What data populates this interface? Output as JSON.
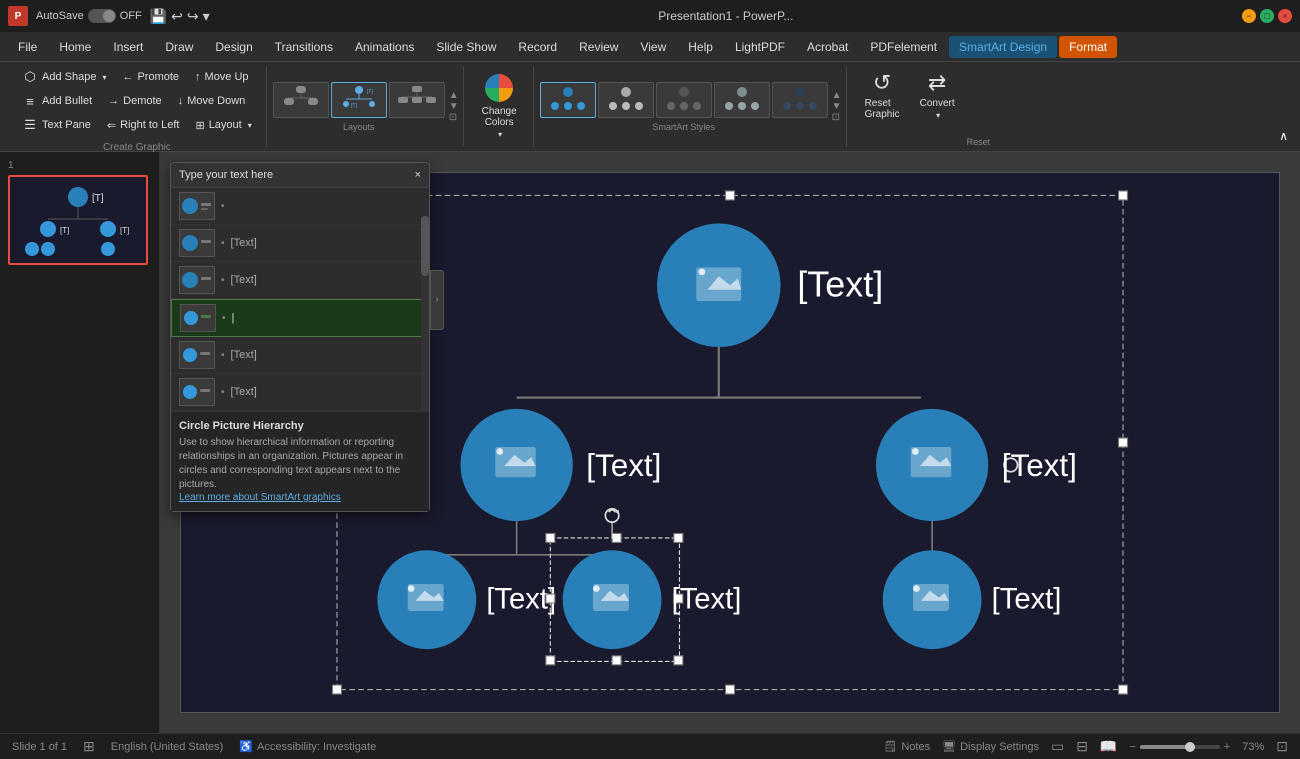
{
  "titlebar": {
    "app_name": "Presentation1 - PowerP...",
    "autosave_label": "AutoSave",
    "off_label": "OFF",
    "undo_title": "Undo",
    "redo_title": "Redo"
  },
  "menubar": {
    "items": [
      "File",
      "Home",
      "Insert",
      "Draw",
      "Design",
      "Transitions",
      "Animations",
      "Slide Show",
      "Record",
      "Review",
      "View",
      "Help",
      "LightPDF",
      "Acrobat",
      "PDFelement"
    ],
    "active": "SmartArt Design",
    "secondary": "Format"
  },
  "ribbon": {
    "create_graphic": {
      "label": "Create Graphic",
      "add_shape": "Add Shape",
      "add_bullet": "Add Bullet",
      "text_pane": "Text Pane",
      "promote": "Promote",
      "demote": "Demote",
      "right_to_left": "Right to Left",
      "move_up": "Move Up",
      "move_down": "Move Down",
      "layout": "Layout"
    },
    "layouts": {
      "label": "Layouts"
    },
    "smartart_styles": {
      "label": "SmartArt Styles"
    },
    "change_colors": {
      "label": "Change\nColors"
    },
    "reset": {
      "label": "Reset",
      "reset_graphic": "Reset\nGraphic",
      "convert": "Convert"
    }
  },
  "textpane": {
    "title": "Type your text here",
    "items": [
      {
        "placeholder": "",
        "value": "",
        "indent": 0
      },
      {
        "placeholder": "[Text]",
        "value": "[Text]",
        "indent": 0
      },
      {
        "placeholder": "[Text]",
        "value": "[Text]",
        "indent": 0
      },
      {
        "placeholder": "",
        "value": "",
        "indent": 1,
        "active": true
      },
      {
        "placeholder": "[Text]",
        "value": "[Text]",
        "indent": 1
      },
      {
        "placeholder": "[Text]",
        "value": "[Text]",
        "indent": 1
      }
    ],
    "footer_title": "Circle Picture Hierarchy",
    "footer_desc": "Use to show hierarchical information or reporting relationships in an organization. Pictures appear in circles and corresponding text appears next to the pictures.",
    "footer_link": "Learn more about SmartArt graphics"
  },
  "diagram": {
    "nodes": [
      {
        "level": 1,
        "text": "[Text]",
        "has_pic": true
      },
      {
        "level": 2,
        "text": "[Text]",
        "has_pic": true,
        "left": true
      },
      {
        "level": 2,
        "text": "[Text]",
        "has_pic": true,
        "left": false
      },
      {
        "level": 3,
        "text": "[Text]",
        "has_pic": true,
        "parent": "left"
      },
      {
        "level": 3,
        "text": "[Text]",
        "has_pic": true,
        "parent": "left",
        "selected": true
      },
      {
        "level": 3,
        "text": "[Text]",
        "has_pic": true,
        "parent": "right"
      }
    ]
  },
  "statusbar": {
    "slide_info": "Slide 1 of 1",
    "language": "English (United States)",
    "accessibility": "Accessibility: Investigate",
    "notes_label": "Notes",
    "display_settings": "Display Settings",
    "zoom": "73%"
  }
}
